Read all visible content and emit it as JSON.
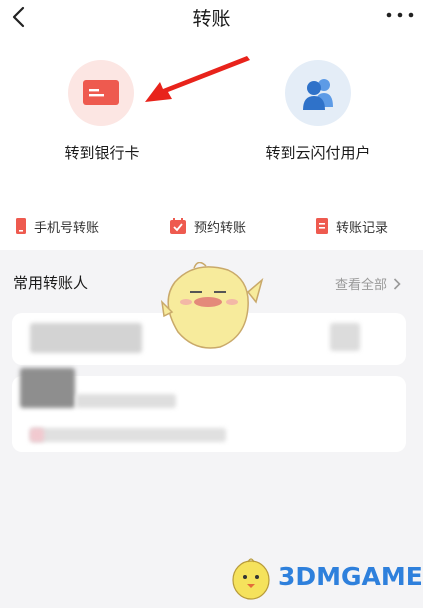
{
  "header": {
    "title": "转账"
  },
  "tiles": {
    "bank": {
      "label": "转到银行卡"
    },
    "ysf": {
      "label": "转到云闪付用户"
    }
  },
  "actions": {
    "phone": {
      "label": "手机号转账"
    },
    "book": {
      "label": "预约转账"
    },
    "record": {
      "label": "转账记录"
    }
  },
  "frequent": {
    "title": "常用转账人",
    "view_all": "查看全部"
  },
  "watermark": {
    "text": "3DMGAME"
  },
  "colors": {
    "accent_red": "#ee5a4f",
    "accent_blue": "#3d82d6",
    "annotation_arrow": "#e8231b",
    "watermark": "#2e80dc"
  },
  "icons": {
    "back": "chevron-left-icon",
    "more": "more-dots-icon",
    "bank": "bank-card-icon",
    "ysf": "users-icon",
    "phone": "phone-icon",
    "book": "calendar-icon",
    "record": "document-icon",
    "view_all": "chevron-right-icon"
  }
}
